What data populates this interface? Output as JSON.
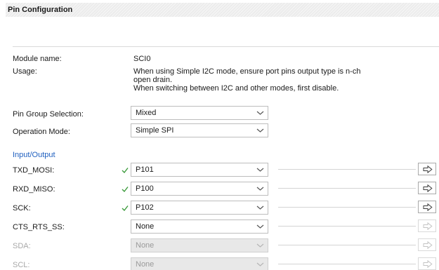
{
  "header": {
    "title": "Pin Configuration"
  },
  "module": {
    "label": "Module name:",
    "value": "SCI0"
  },
  "usage": {
    "label": "Usage:",
    "lines": [
      "When using Simple I2C mode, ensure port pins output type is n-ch",
      "open drain.",
      "When switching between I2C and other modes, first disable."
    ]
  },
  "pin_group": {
    "label": "Pin Group Selection:",
    "value": "Mixed"
  },
  "operation_mode": {
    "label": "Operation Mode:",
    "value": "Simple SPI"
  },
  "section_title": "Input/Output",
  "pins": [
    {
      "label": "TXD_MOSI:",
      "value": "P101",
      "checked": true,
      "enabled": true
    },
    {
      "label": "RXD_MISO:",
      "value": "P100",
      "checked": true,
      "enabled": true
    },
    {
      "label": "SCK:",
      "value": "P102",
      "checked": true,
      "enabled": true
    },
    {
      "label": "CTS_RTS_SS:",
      "value": "None",
      "checked": false,
      "enabled": true
    },
    {
      "label": "SDA:",
      "value": "None",
      "checked": false,
      "enabled": false
    },
    {
      "label": "SCL:",
      "value": "None",
      "checked": false,
      "enabled": false
    }
  ],
  "colors": {
    "link": "#1f5fbf",
    "check": "#3a9a3a",
    "disabled_text": "#a8a8a8"
  },
  "icons": {
    "check": "check-icon",
    "arrow": "right-arrow-icon",
    "dropdown": "chevron-down-icon"
  }
}
